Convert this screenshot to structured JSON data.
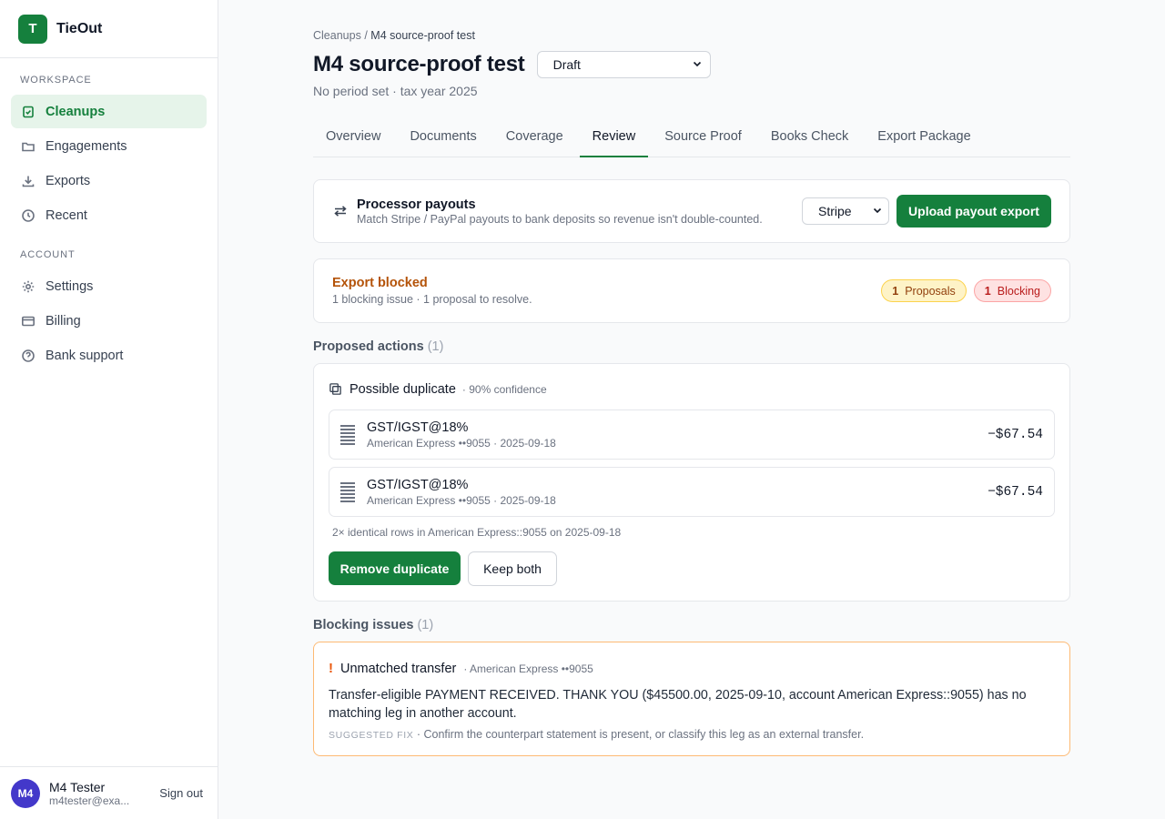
{
  "app": {
    "logo_letter": "T",
    "name": "TieOut"
  },
  "sidebar": {
    "workspace_heading": "WORKSPACE",
    "workspace_items": [
      {
        "label": "Cleanups",
        "icon": "clipboard-check-icon",
        "active": true
      },
      {
        "label": "Engagements",
        "icon": "folder-icon"
      },
      {
        "label": "Exports",
        "icon": "download-icon"
      },
      {
        "label": "Recent",
        "icon": "clock-icon"
      }
    ],
    "account_heading": "ACCOUNT",
    "account_items": [
      {
        "label": "Settings",
        "icon": "gear-icon"
      },
      {
        "label": "Billing",
        "icon": "credit-card-icon"
      },
      {
        "label": "Bank support",
        "icon": "help-circle-icon"
      }
    ]
  },
  "user": {
    "initials": "M4",
    "name": "M4 Tester",
    "email": "m4tester@exa...",
    "signout_label": "Sign out"
  },
  "breadcrumb": {
    "parent": "Cleanups",
    "separator": "/",
    "current": "M4 source-proof test"
  },
  "page": {
    "title": "M4 source-proof test",
    "status_value": "Draft",
    "subtitle": "No period set · tax year 2025"
  },
  "tabs": [
    {
      "label": "Overview"
    },
    {
      "label": "Documents"
    },
    {
      "label": "Coverage"
    },
    {
      "label": "Review",
      "active": true
    },
    {
      "label": "Source Proof"
    },
    {
      "label": "Books Check"
    },
    {
      "label": "Export Package"
    }
  ],
  "payouts": {
    "title": "Processor payouts",
    "description": "Match Stripe / PayPal payouts to bank deposits so revenue isn't double-counted.",
    "processor_value": "Stripe",
    "upload_label": "Upload payout export"
  },
  "export_status": {
    "title": "Export blocked",
    "description": "1 blocking issue · 1 proposal to resolve.",
    "proposals_count": "1",
    "proposals_label": "Proposals",
    "blocking_count": "1",
    "blocking_label": "Blocking"
  },
  "proposed_actions": {
    "heading": "Proposed actions",
    "count": "(1)",
    "item": {
      "title": "Possible duplicate",
      "confidence": "· 90% confidence",
      "transactions": [
        {
          "description": "GST/IGST@18%",
          "meta": "American Express ••9055 · 2025-09-18",
          "amount": "−$67.54"
        },
        {
          "description": "GST/IGST@18%",
          "meta": "American Express ••9055 · 2025-09-18",
          "amount": "−$67.54"
        }
      ],
      "note": "2× identical rows in American Express::9055 on 2025-09-18",
      "remove_label": "Remove duplicate",
      "keep_label": "Keep both"
    }
  },
  "blocking_issues": {
    "heading": "Blocking issues",
    "count": "(1)",
    "item": {
      "icon": "!",
      "title": "Unmatched transfer",
      "account": "· American Express ••9055",
      "body": "Transfer-eligible PAYMENT RECEIVED. THANK YOU ($45500.00, 2025-09-10, account American Express::9055) has no matching leg in another account.",
      "fix_label": "SUGGESTED FIX",
      "fix_text": " · Confirm the counterpart statement is present, or classify this leg as an external transfer."
    }
  },
  "colors": {
    "brand": "#15803d",
    "warning": "#b45309",
    "danger": "#b91c1c",
    "avatar": "#4338ca"
  }
}
